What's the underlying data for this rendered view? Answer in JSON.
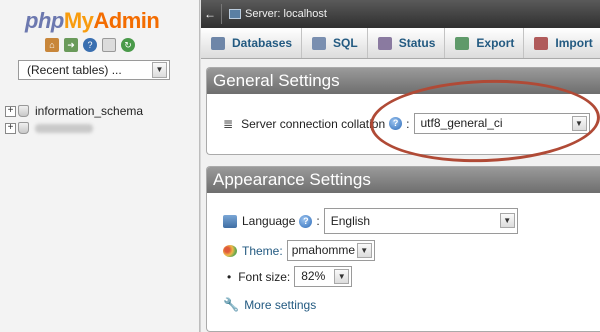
{
  "logo": {
    "php": "php",
    "my": "My",
    "admin": "Admin"
  },
  "nav_icons": [
    "home-icon",
    "exit-icon",
    "help-icon",
    "docs-icon",
    "reload-icon"
  ],
  "recent_tables": {
    "value": "(Recent tables) ..."
  },
  "databases": [
    {
      "name": "information_schema",
      "blurred": false
    },
    {
      "name": "",
      "blurred": true
    }
  ],
  "topbar": {
    "collapse_glyph": "←",
    "server_label": "Server: localhost"
  },
  "tabs": [
    {
      "label": "Databases",
      "icon": "databases-icon",
      "color": "#6e86a8"
    },
    {
      "label": "SQL",
      "icon": "sql-icon",
      "color": "#7a8fb0"
    },
    {
      "label": "Status",
      "icon": "status-icon",
      "color": "#8a7aa0"
    },
    {
      "label": "Export",
      "icon": "export-icon",
      "color": "#5f9a6a"
    },
    {
      "label": "Import",
      "icon": "import-icon",
      "color": "#b05a5a"
    }
  ],
  "general_settings": {
    "title": "General Settings",
    "collation_label": "Server connection collation",
    "collation_value": "utf8_general_ci"
  },
  "appearance_settings": {
    "title": "Appearance Settings",
    "language_label": "Language",
    "language_value": "English",
    "theme_label": "Theme:",
    "theme_value": "pmahomme",
    "font_size_label": "Font size:",
    "font_size_value": "82%",
    "more_settings": "More settings"
  },
  "colors": {
    "annotation_ellipse": "#b04a36",
    "link": "#235a81",
    "panel_header": "#7d7d7d"
  }
}
